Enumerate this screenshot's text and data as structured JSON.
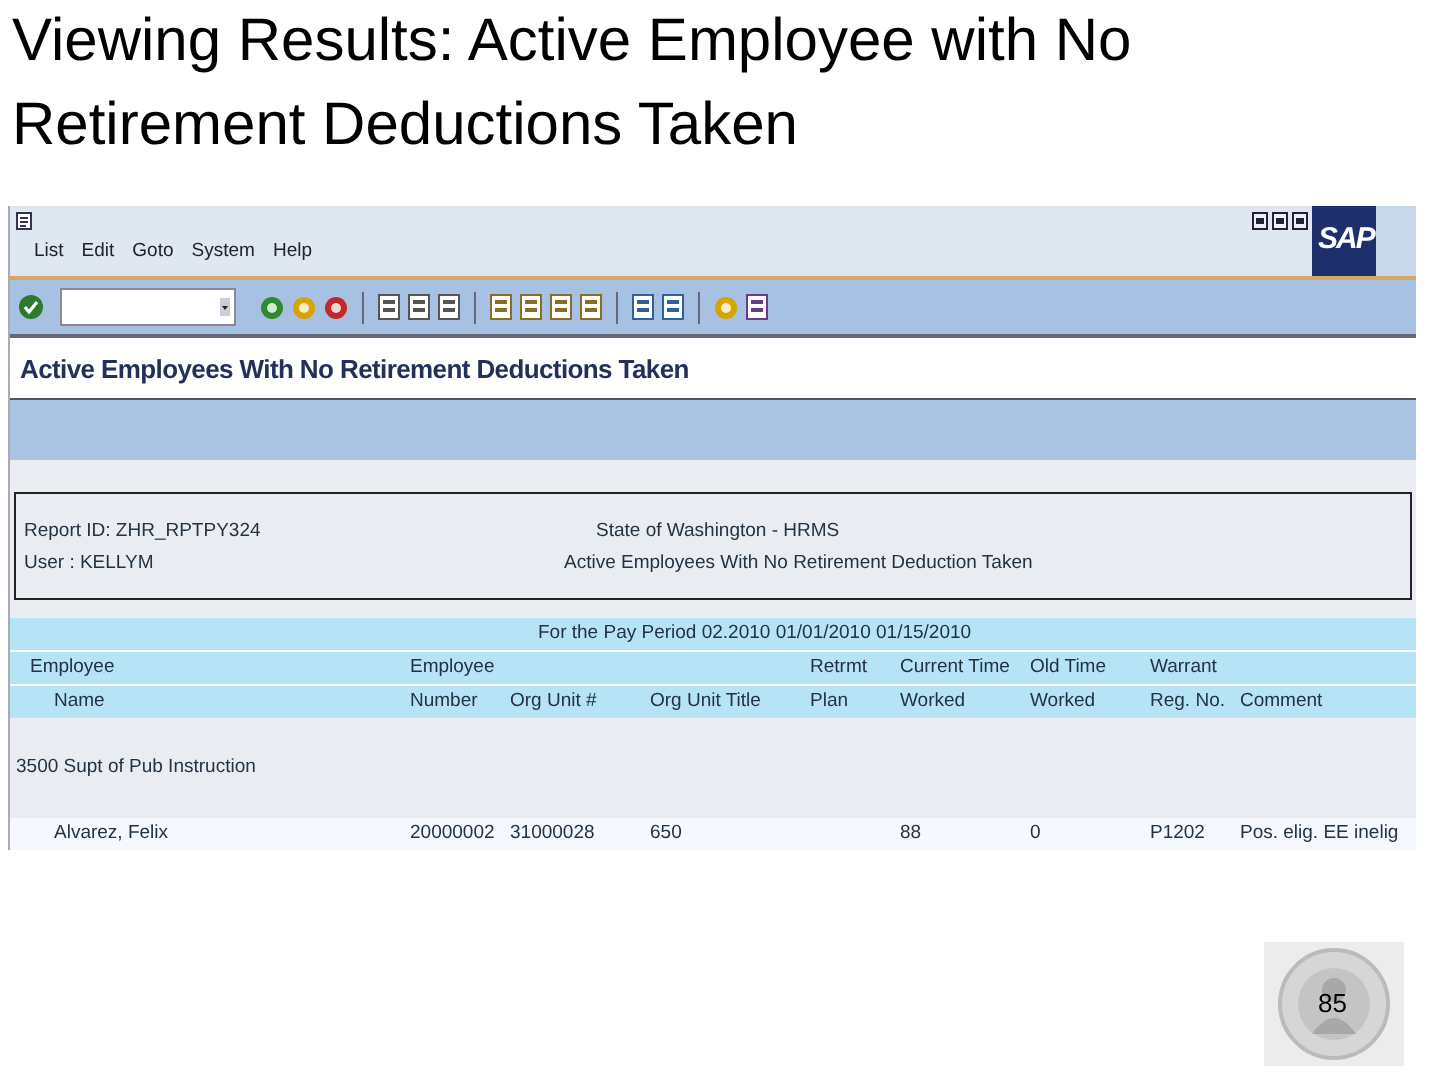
{
  "slide": {
    "title": "Viewing Results: Active Employee with No Retirement Deductions Taken",
    "page_number": "85"
  },
  "window": {
    "logo": "SAP",
    "menu": [
      "List",
      "Edit",
      "Goto",
      "System",
      "Help"
    ],
    "screen_title": "Active Employees With No Retirement Deductions Taken",
    "report_header": {
      "report_id": "Report ID: ZHR_RPTPY324",
      "user": "User      : KELLYM",
      "organization": "State of Washington - HRMS",
      "report_title": "Active Employees With No Retirement Deduction Taken"
    },
    "period": "For the Pay Period 02.2010 01/01/2010 01/15/2010",
    "columns": [
      {
        "line_1": "Employee",
        "line_2": "Name"
      },
      {
        "line_1": "Employee",
        "line_2": "Number"
      },
      {
        "line_2": "Org Unit #"
      },
      {
        "line_2": "Org Unit Title"
      },
      {
        "line_1": "Retrmt",
        "line_2": "Plan"
      },
      {
        "line_1": "Current Time",
        "line_2": "Worked"
      },
      {
        "line_1": "Old Time",
        "line_2": "Worked"
      },
      {
        "line_1": "Warrant",
        "line_2": "Reg. No."
      },
      {
        "line_2": "Comment"
      }
    ],
    "group": "3500 Supt of Pub Instruction",
    "rows": [
      [
        "Alvarez, Felix",
        "20000002",
        "31000028",
        "650",
        "",
        "88",
        "0",
        "P1202",
        "Pos. elig. EE inelig"
      ]
    ]
  }
}
